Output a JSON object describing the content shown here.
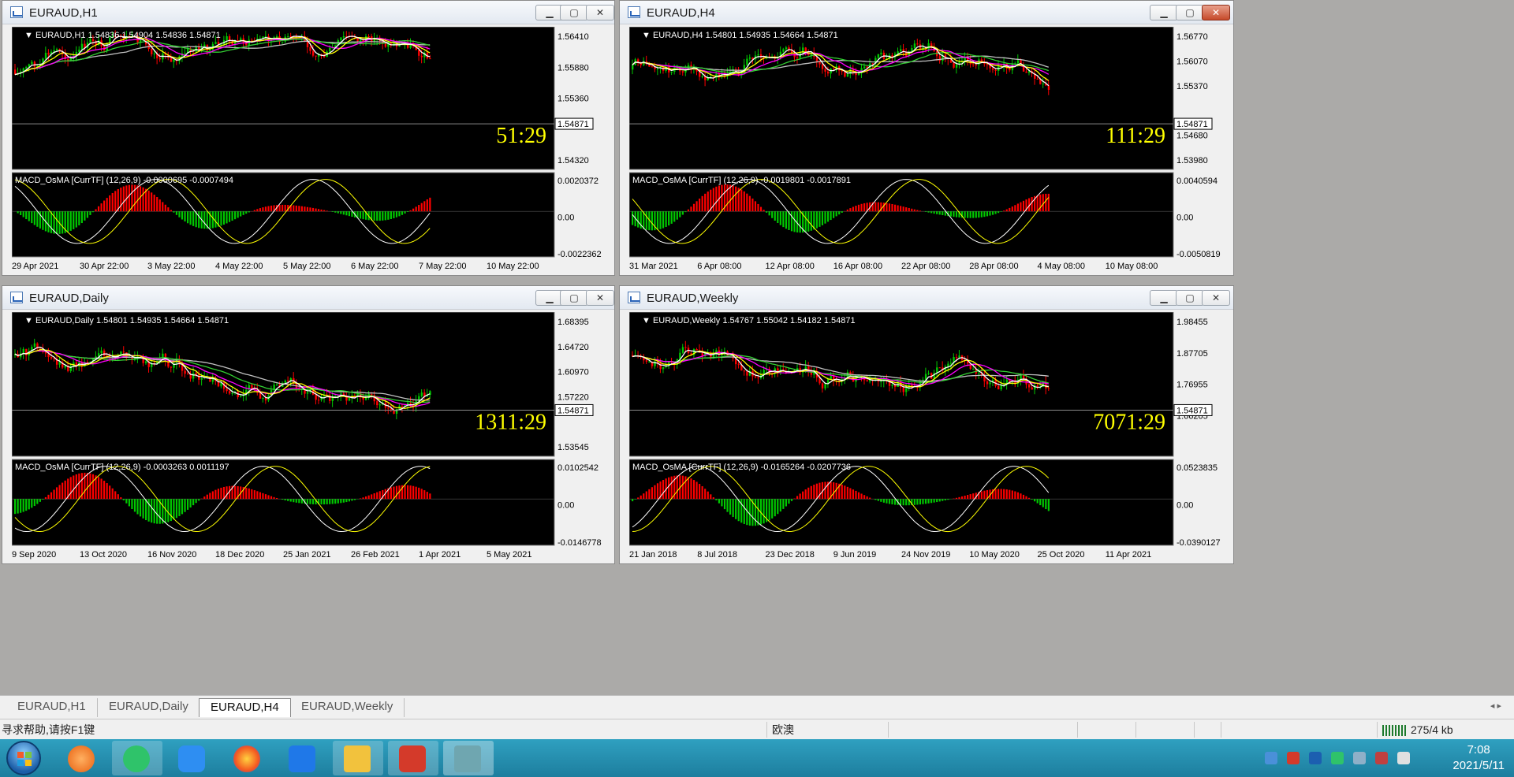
{
  "windows": [
    {
      "title": "EURAUD,H1",
      "header": "EURAUD,H1  1.54836 1.54904 1.54836 1.54871",
      "price_ticks": [
        "1.56410",
        "1.55880",
        "1.55360",
        "1.54871",
        "1.54320"
      ],
      "current_price": "1.54871",
      "countdown": "51:29",
      "macd_header": "MACD_OsMA [CurrTF] (12,26,9) -0.0000695 -0.0007494",
      "macd_ticks": [
        "0.0020372",
        "0.00",
        "-0.0022362"
      ],
      "time_ticks": [
        "29 Apr 2021",
        "30 Apr 22:00",
        "3 May 22:00",
        "4 May 22:00",
        "5 May 22:00",
        "6 May 22:00",
        "7 May 22:00",
        "10 May 22:00"
      ]
    },
    {
      "title": "EURAUD,H4",
      "header": "EURAUD,H4  1.54801 1.54935 1.54664 1.54871",
      "price_ticks": [
        "1.56770",
        "1.56070",
        "1.55370",
        "1.54871",
        "1.54680",
        "1.53980"
      ],
      "current_price": "1.54871",
      "countdown": "111:29",
      "macd_header": "MACD_OsMA [CurrTF] (12,26,9) -0.0019801 -0.0017891",
      "macd_ticks": [
        "0.0040594",
        "0.00",
        "-0.0050819"
      ],
      "time_ticks": [
        "31 Mar 2021",
        "6 Apr 08:00",
        "12 Apr 08:00",
        "16 Apr 08:00",
        "22 Apr 08:00",
        "28 Apr 08:00",
        "4 May 08:00",
        "10 May 08:00"
      ]
    },
    {
      "title": "EURAUD,Daily",
      "header": "EURAUD,Daily  1.54801 1.54935 1.54664 1.54871",
      "price_ticks": [
        "1.68395",
        "1.64720",
        "1.60970",
        "1.57220",
        "1.54871",
        "1.53545"
      ],
      "current_price": "1.54871",
      "countdown": "1311:29",
      "macd_header": "MACD_OsMA [CurrTF] (12,26,9) -0.0003263 0.0011197",
      "macd_ticks": [
        "0.0102542",
        "0.00",
        "-0.0146778"
      ],
      "time_ticks": [
        "9 Sep 2020",
        "13 Oct 2020",
        "16 Nov 2020",
        "18 Dec 2020",
        "25 Jan 2021",
        "26 Feb 2021",
        "1 Apr 2021",
        "5 May 2021"
      ]
    },
    {
      "title": "EURAUD,Weekly",
      "header": "EURAUD,Weekly  1.54767 1.55042 1.54182 1.54871",
      "price_ticks": [
        "1.98455",
        "1.87705",
        "1.76955",
        "1.66205",
        "1.54871"
      ],
      "current_price": "1.54871",
      "countdown": "7071:29",
      "macd_header": "MACD_OsMA [CurrTF] (12,26,9) -0.0165264 -0.0207736",
      "macd_ticks": [
        "0.0523835",
        "0.00",
        "-0.0390127"
      ],
      "time_ticks": [
        "21 Jan 2018",
        "8 Jul 2018",
        "23 Dec 2018",
        "9 Jun 2019",
        "24 Nov 2019",
        "10 May 2020",
        "25 Oct 2020",
        "11 Apr 2021"
      ]
    }
  ],
  "window_buttons": {
    "minimize": "▁",
    "maximize": "▢",
    "close": "✕"
  },
  "chart_tabs": [
    "EURAUD,H1",
    "EURAUD,Daily",
    "EURAUD,H4",
    "EURAUD,Weekly"
  ],
  "active_tab": "EURAUD,H4",
  "tab_arrows": "◂ ▸",
  "status": {
    "help": "寻求帮助,请按F1键",
    "profile": "欧澳",
    "traffic": "275/4 kb"
  },
  "clock": {
    "time": "7:08",
    "date": "2021/5/11"
  },
  "colors": {
    "chart_bg": "#000000",
    "bull": "#00c800",
    "bear": "#ff0000",
    "ma_fast": "#ffffff",
    "ma_yellow": "#ffff00",
    "ma_magenta": "#ff00ff",
    "ma_green": "#32cd32",
    "ma_gray": "#c0c0c0",
    "countdown": "#ffff00"
  },
  "icons": {
    "start": "windows-start-icon",
    "tray": [
      "usb-icon",
      "wps-icon",
      "shield-icon",
      "wechat-icon",
      "network-icon",
      "speaker-icon",
      "signal-icon"
    ]
  }
}
